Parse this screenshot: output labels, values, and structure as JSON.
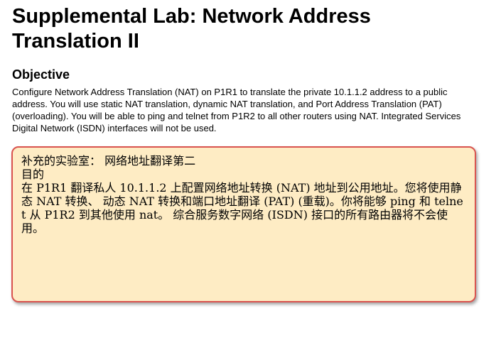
{
  "document": {
    "title": "Supplemental Lab: Network Address Translation II",
    "objective_heading": "Objective",
    "objective_text": "Configure Network Address Translation (NAT) on P1R1 to translate the private 10.1.1.2 address to a public address. You will use static NAT translation, dynamic NAT translation, and Port Address Translation (PAT) (overloading). You will be able to ping and telnet from P1R2 to all other routers using NAT. Integrated Services Digital Network (ISDN) interfaces will not be used."
  },
  "translation_popup": {
    "title_line": "补充的实验室： 网络地址翻译第二",
    "heading_line": "目的",
    "body_text": "在 P1R1 翻译私人 10.1.1.2 上配置网络地址转换 (NAT) 地址到公用地址。您将使用静态 NAT 转换、 动态 NAT 转换和端口地址翻译 (PAT) (重载)。你将能够 ping 和 telnet 从 P1R2 到其他使用 nat。 综合服务数字网络 (ISDN) 接口的所有路由器将不会使用。",
    "background_color": "#feecc4",
    "border_color": "#d9534f"
  }
}
